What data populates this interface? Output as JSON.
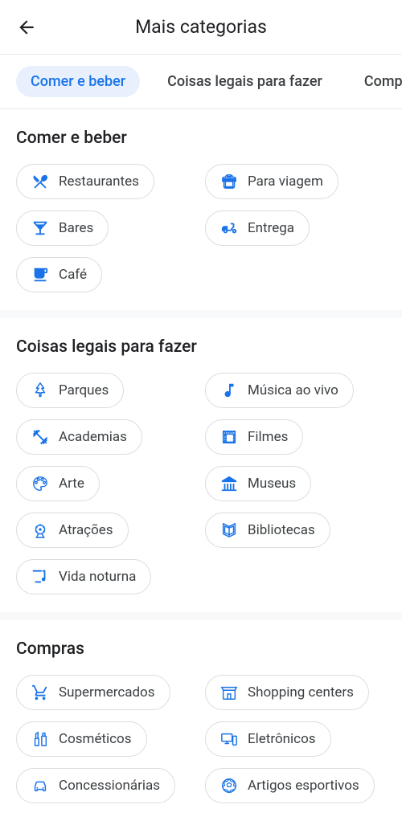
{
  "header": {
    "title": "Mais categorias"
  },
  "tabs": {
    "t0": "Comer e beber",
    "t1": "Coisas legais para fazer",
    "t2": "Compras"
  },
  "sections": {
    "food": {
      "title": "Comer e beber",
      "items": {
        "restaurants": "Restaurantes",
        "takeout": "Para viagem",
        "bars": "Bares",
        "delivery": "Entrega",
        "cafe": "Café"
      }
    },
    "fun": {
      "title": "Coisas legais para fazer",
      "items": {
        "parks": "Parques",
        "music": "Música ao vivo",
        "gyms": "Academias",
        "movies": "Filmes",
        "art": "Arte",
        "museums": "Museus",
        "attractions": "Atrações",
        "libraries": "Bibliotecas",
        "nightlife": "Vida noturna"
      }
    },
    "shop": {
      "title": "Compras",
      "items": {
        "groceries": "Supermercados",
        "malls": "Shopping centers",
        "cosmetics": "Cosméticos",
        "electronics": "Eletrônicos",
        "cars": "Concessionárias",
        "sports": "Artigos esportivos"
      }
    }
  }
}
